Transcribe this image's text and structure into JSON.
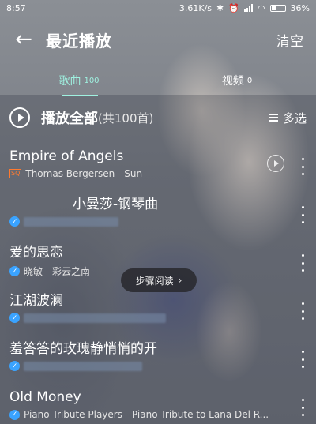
{
  "status_bar": {
    "time": "8:57",
    "network_speed": "3.61K/s",
    "battery": "36%"
  },
  "header": {
    "title": "最近播放",
    "clear_label": "清空"
  },
  "tabs": [
    {
      "label": "歌曲",
      "count": "100",
      "active": true
    },
    {
      "label": "视频",
      "count": "0",
      "active": false
    }
  ],
  "play_all": {
    "label": "播放全部",
    "count_text": "(共100首)",
    "multi_select_label": "多选"
  },
  "songs": [
    {
      "name": "Empire of Angels",
      "meta": "Thomas Bergersen - Sun",
      "badge": "SQ",
      "has_mv": true
    },
    {
      "name": "小曼莎-钢琴曲",
      "meta": "",
      "badge": "check",
      "has_mv": false
    },
    {
      "name": "爱的思恋",
      "meta": "晓敏 - 彩云之南",
      "badge": "check",
      "has_mv": false
    },
    {
      "name": "江湖波澜",
      "meta": "",
      "badge": "check",
      "has_mv": false
    },
    {
      "name": "羞答答的玫瑰静悄悄的开",
      "meta": "",
      "badge": "check",
      "has_mv": false
    },
    {
      "name": "Old Money",
      "meta": "Piano Tribute Players - Piano Tribute to Lana Del R...",
      "badge": "check",
      "has_mv": false
    }
  ],
  "tooltip": {
    "label": "步骤阅读",
    "chevron": "›"
  },
  "colors": {
    "accent": "#9ff1e0",
    "check_blue": "#3aa3ff",
    "sq_orange": "#ff7a2f"
  },
  "icons": {
    "back": "arrow-left-icon",
    "play_all": "play-circle-icon",
    "multi_select": "list-icon",
    "more": "more-vertical-icon",
    "mv": "mv-play-icon"
  }
}
